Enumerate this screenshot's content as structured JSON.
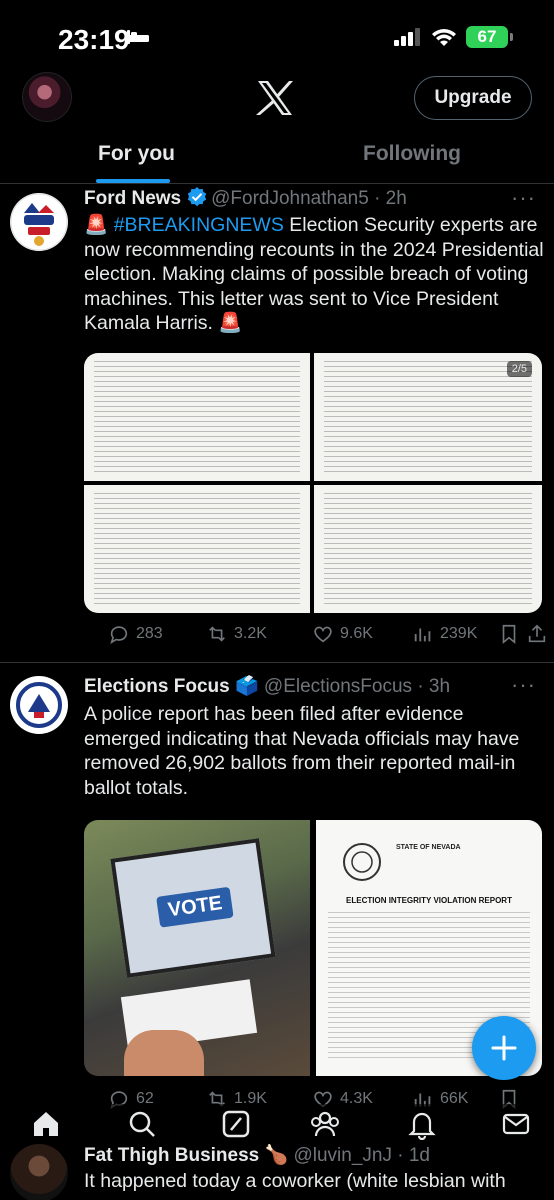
{
  "status_bar": {
    "time": "23:19",
    "battery": "67"
  },
  "top_bar": {
    "upgrade_label": "Upgrade"
  },
  "tabs": [
    {
      "label": "For you",
      "active": true
    },
    {
      "label": "Following",
      "active": false
    }
  ],
  "posts": [
    {
      "name": "Ford News",
      "handle": "@FordJohnathan5 · 2h",
      "verified": true,
      "text_prefix": "🚨 ",
      "hashtag": "#BREAKINGNEWS",
      "text": " Election Security experts are now recommending recounts in the 2024 Presidential election. Making claims of possible breach of voting machines. This letter was sent to Vice President Kamala Harris. 🚨",
      "media_badge": "2/5",
      "stats": {
        "replies": "283",
        "reposts": "3.2K",
        "likes": "9.6K",
        "views": "239K"
      }
    },
    {
      "name": "Elections Focus 🗳️",
      "handle": "@ElectionsFocus · 3h",
      "verified": false,
      "text": "A police report has been filed after evidence emerged indicating that Nevada officials may have removed 26,902 ballots from their reported mail-in ballot totals.",
      "media": {
        "vote_sign": "VOTE",
        "report_heading": "STATE OF NEVADA",
        "report_title": "ELECTION INTEGRITY VIOLATION REPORT"
      },
      "stats": {
        "replies": "62",
        "reposts": "1.9K",
        "likes": "4.3K",
        "views": "66K"
      }
    }
  ],
  "peek_post": {
    "name": "Fat Thigh Business 🍗",
    "handle": "@luvin_JnJ · 1d",
    "text": "It happened today a coworker (white lesbian with"
  },
  "colors": {
    "accent": "#1d9bf0",
    "muted": "#71767b",
    "text": "#e7e9ea",
    "border": "#2f3336"
  }
}
